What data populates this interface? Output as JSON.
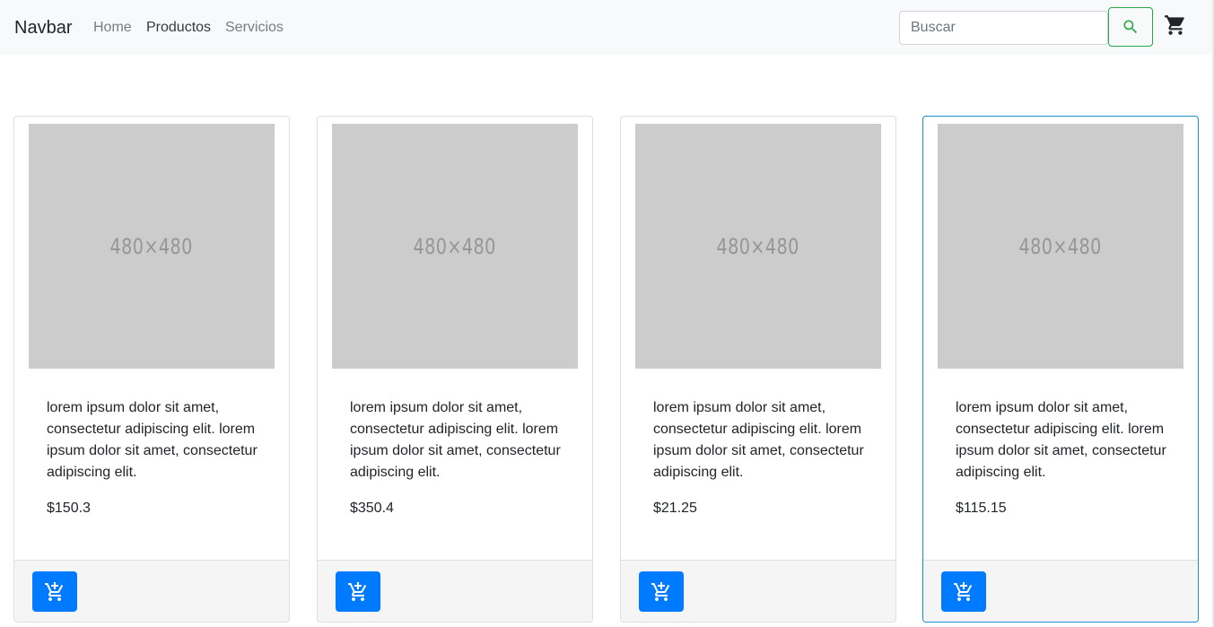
{
  "navbar": {
    "brand": "Navbar",
    "links": [
      {
        "label": "Home",
        "active": false
      },
      {
        "label": "Productos",
        "active": true
      },
      {
        "label": "Servicios",
        "active": false
      }
    ],
    "search": {
      "placeholder": "Buscar",
      "value": ""
    },
    "search_icon": "search-icon",
    "cart_icon": "cart-icon"
  },
  "products": [
    {
      "image_label": "480×480",
      "description": "lorem ipsum dolor sit amet, consectetur adipiscing elit. lorem ipsum dolor sit amet, consectetur adipiscing elit.",
      "price": "$150.3",
      "button_icon": "add-to-cart-icon"
    },
    {
      "image_label": "480×480",
      "description": "lorem ipsum dolor sit amet, consectetur adipiscing elit. lorem ipsum dolor sit amet, consectetur adipiscing elit.",
      "price": "$350.4",
      "button_icon": "add-to-cart-icon"
    },
    {
      "image_label": "480×480",
      "description": "lorem ipsum dolor sit amet, consectetur adipiscing elit. lorem ipsum dolor sit amet, consectetur adipiscing elit.",
      "price": "$21.25",
      "button_icon": "add-to-cart-icon"
    },
    {
      "image_label": "480×480",
      "description": "lorem ipsum dolor sit amet, consectetur adipiscing elit. lorem ipsum dolor sit amet, consectetur adipiscing elit.",
      "price": "$115.15",
      "button_icon": "add-to-cart-icon"
    }
  ],
  "colors": {
    "navbar_bg": "#f8f9fa",
    "search_button_border": "#28a745",
    "primary_button": "#007bff",
    "highlight_border": "#1a8fc9",
    "image_placeholder": "#cccccc"
  }
}
